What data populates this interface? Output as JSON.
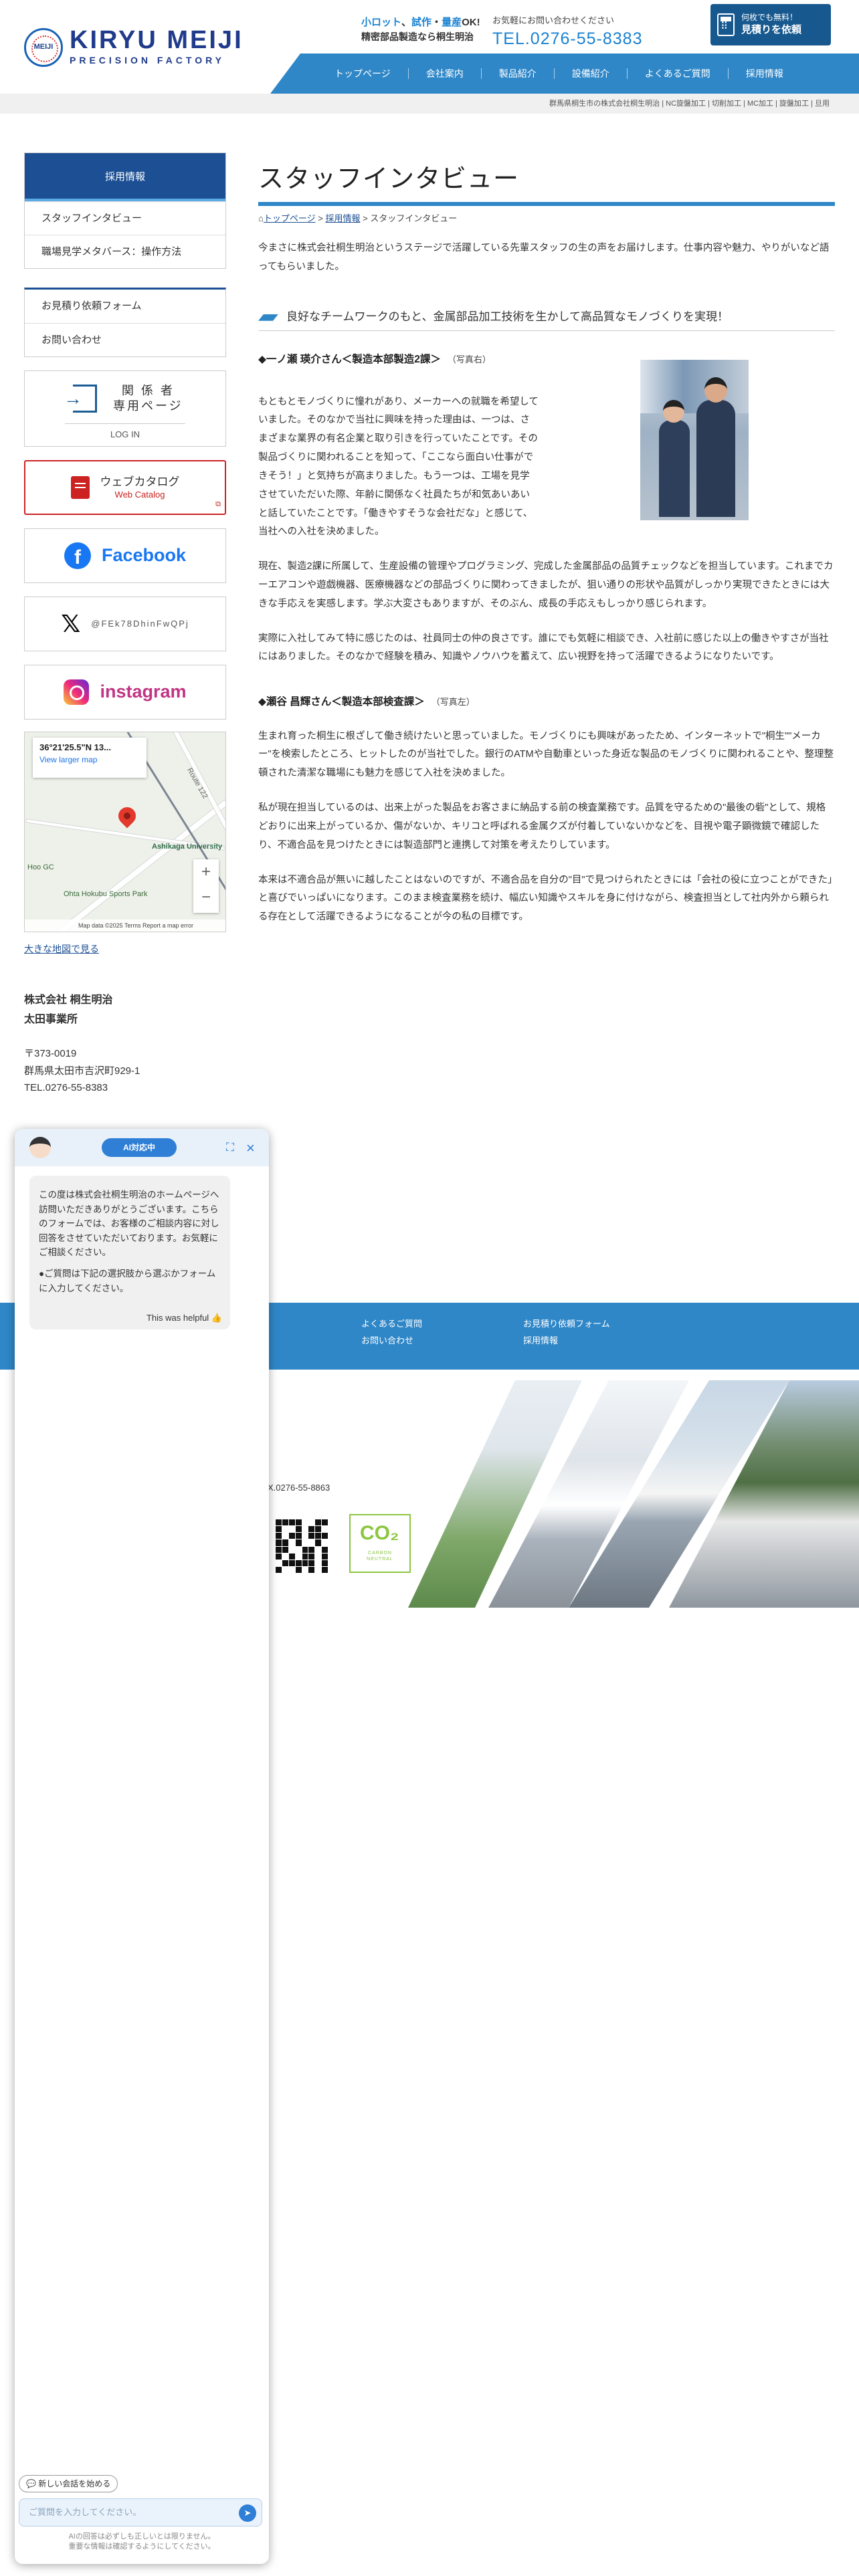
{
  "header": {
    "logo": {
      "mark": "MEIJI",
      "line1": "KIRYU MEIJI",
      "line2": "PRECISION FACTORY"
    },
    "tagline": {
      "parts": [
        "小ロット",
        "、",
        "試作",
        "・",
        "量産",
        "OK!"
      ],
      "line2": "精密部品製造なら桐生明治"
    },
    "contact": {
      "label": "お気軽にお問い合わせください",
      "tel": "TEL.0276-55-8383"
    },
    "cta": {
      "small": "何枚でも無料！",
      "label": "見積りを依頼",
      "icon": "calculator-icon"
    },
    "nav": [
      "トップページ",
      "会社案内",
      "製品紹介",
      "設備紹介",
      "よくあるご質問",
      "採用情報"
    ],
    "subbar": "群馬県桐生市の株式会社桐生明治 | NC旋盤加工 | 切削加工 | MC加工 | 旋盤加工 | 旦用"
  },
  "sidebar": {
    "heading": "採用情報",
    "recruit_items": [
      "スタッフインタビュー",
      "職場見学メタバース：操作方法"
    ],
    "contact_items": [
      "お見積り依頼フォーム",
      "お問い合わせ"
    ],
    "login": {
      "title_line1": "関 係 者",
      "title_line2": "専用ページ",
      "sub": "LOG IN",
      "icon": "login-icon"
    },
    "catalog": {
      "title": "ウェブカタログ",
      "sub": "Web Catalog",
      "icon": "catalog-icon"
    },
    "facebook": {
      "label": "Facebook",
      "icon": "facebook-icon"
    },
    "x": {
      "handle": "@FEk78DhinFwQPj",
      "icon": "x-icon"
    },
    "instagram": {
      "label": "instagram",
      "icon": "instagram-icon"
    },
    "map": {
      "coords": "36°21'25.5\"N 13...",
      "view_larger": "View larger map",
      "place1": "Ashikaga University",
      "place2": "Ohta Hokubu Sports Park",
      "place3": "Hoo GC",
      "route": "Route 122",
      "footer": "Map data ©2025   Terms   Report a map error"
    },
    "map_link": "大きな地図で見る",
    "company_name": "株式会社 桐生明治",
    "office": "太田事業所",
    "postal": "〒373-0019",
    "address": "群馬県太田市吉沢町929-1",
    "tel": "TEL.0276-55-8383"
  },
  "main": {
    "title": "スタッフインタビュー",
    "breadcrumb": [
      "トップページ",
      "採用情報",
      "スタッフインタビュー"
    ],
    "intro": "今まさに株式会社桐生明治というステージで活躍している先輩スタッフの生の声をお届けします。仕事内容や魅力、やりがいなど語ってもらいました。",
    "lead": "良好なチームワークのもと、金属部品加工技術を生かして高品質なモノづくりを実現！",
    "person1": {
      "name": "◆一ノ瀬 瑛介さん＜製造本部製造2課＞",
      "note": "（写真右）"
    },
    "p1": "もともとモノづくりに憧れがあり、メーカーへの就職を希望していました。そのなかで当社に興味を持った理由は、一つは、さまざまな業界の有名企業と取り引きを行っていたことです。その製品づくりに関われることを知って、「ここなら面白い仕事ができそう！」と気持ちが高まりました。もう一つは、工場を見学させていただいた際、年齢に関係なく社員たちが和気あいあいと話していたことです。「働きやすそうな会社だな」と感じて、当社への入社を決めました。",
    "p2": "現在、製造2課に所属して、生産設備の管理やプログラミング、完成した金属部品の品質チェックなどを担当しています。これまでカーエアコンや遊戯機器、医療機器などの部品づくりに関わってきましたが、狙い通りの形状や品質がしっかり実現できたときには大きな手応えを実感します。学ぶ大変さもありますが、そのぶん、成長の手応えもしっかり感じられます。",
    "p3": "実際に入社してみて特に感じたのは、社員同士の仲の良さです。誰にでも気軽に相談でき、入社前に感じた以上の働きやすさが当社にはありました。そのなかで経験を積み、知識やノウハウを蓄えて、広い視野を持って活躍できるようになりたいです。",
    "person2": {
      "name": "◆瀬谷 昌輝さん＜製造本部検査課＞",
      "note": "（写真左）"
    },
    "p4": "生まれ育った桐生に根ざして働き続けたいと思っていました。モノづくりにも興味があったため、インターネットで\"桐生\"\"メーカー\"を検索したところ、ヒットしたのが当社でした。銀行のATMや自動車といった身近な製品のモノづくりに関われることや、整理整頓された清潔な職場にも魅力を感じて入社を決めました。",
    "p5": "私が現在担当しているのは、出来上がった製品をお客さまに納品する前の検査業務です。品質を守るための\"最後の砦\"として、規格どおりに出来上がっているか、傷がないか、キリコと呼ばれる金属クズが付着していないかなどを、目視や電子顕微鏡で確認したり、不適合品を見つけたときには製造部門と連携して対策を考えたりしています。",
    "p6": "本来は不適合品が無いに越したことはないのですが、不適合品を自分の\"目\"で見つけられたときには「会社の役に立つことができた」と喜びでいっぱいになります。このまま検査業務を続け、幅広い知識やスキルを身に付けながら、検査担当として社内外から頼られる存在として活躍できるようになることが今の私の目標です。"
  },
  "footer": {
    "links": [
      "よくあるご質問",
      "お見積り依頼フォーム",
      "お問い合わせ",
      "採用情報"
    ],
    "tel": "X.0276-55-8863",
    "co2": {
      "label": "CO₂",
      "sub": "CARBON NEUTRAL"
    }
  },
  "chat": {
    "badge": "AI対応中",
    "greeting": "この度は株式会社桐生明治のホームページへ訪問いただきありがとうございます。こちらのフォームでは、お客様のご相談内容に対し回答をさせていただいております。お気軽にご相談ください。",
    "prompt": "●ご質問は下記の選択肢から選ぶかフォームに入力してください。",
    "helpful": "This was helpful 👍",
    "new_chat": "💬 新しい会話を始める",
    "input_placeholder": "ご質問を入力してください。",
    "note_line1": "AIの回答は必ずしも正しいとは限りません。",
    "note_line2": "重要な情報は確認するようにしてください。"
  },
  "colors": {
    "primary": "#2f87c8",
    "navy": "#1c4f93",
    "accent": "#c22222"
  }
}
